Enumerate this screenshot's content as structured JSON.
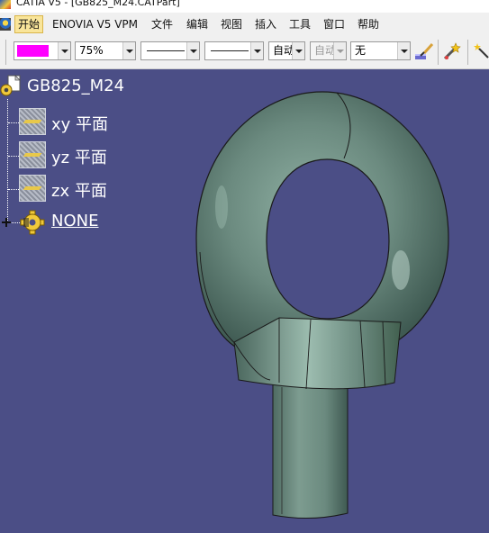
{
  "window": {
    "title": "CATIA V5 - [GB825_M24.CATPart]"
  },
  "menu": {
    "items": [
      {
        "label": "开始",
        "active": true
      },
      {
        "label": "ENOVIA V5 VPM",
        "active": false
      },
      {
        "label": "文件",
        "active": false
      },
      {
        "label": "编辑",
        "active": false
      },
      {
        "label": "视图",
        "active": false
      },
      {
        "label": "插入",
        "active": false
      },
      {
        "label": "工具",
        "active": false
      },
      {
        "label": "窗口",
        "active": false
      },
      {
        "label": "帮助",
        "active": false
      }
    ]
  },
  "toolbar": {
    "color_value": "#ff00ff",
    "transparency": "75%",
    "line_width": "",
    "line_type": "",
    "point_symbol": "自动",
    "layer_auto": "自动",
    "layer": "无",
    "painter_icon": "paintbrush-icon",
    "properties_icon": "wand-icon"
  },
  "tree": {
    "root": "GB825_M24",
    "planes": [
      "xy 平面",
      "yz 平面",
      "zx 平面"
    ],
    "body": "NONE"
  },
  "colors": {
    "background": "#4b4e86",
    "part": "#6b8a7f",
    "menu_active": "#f9e59a"
  }
}
